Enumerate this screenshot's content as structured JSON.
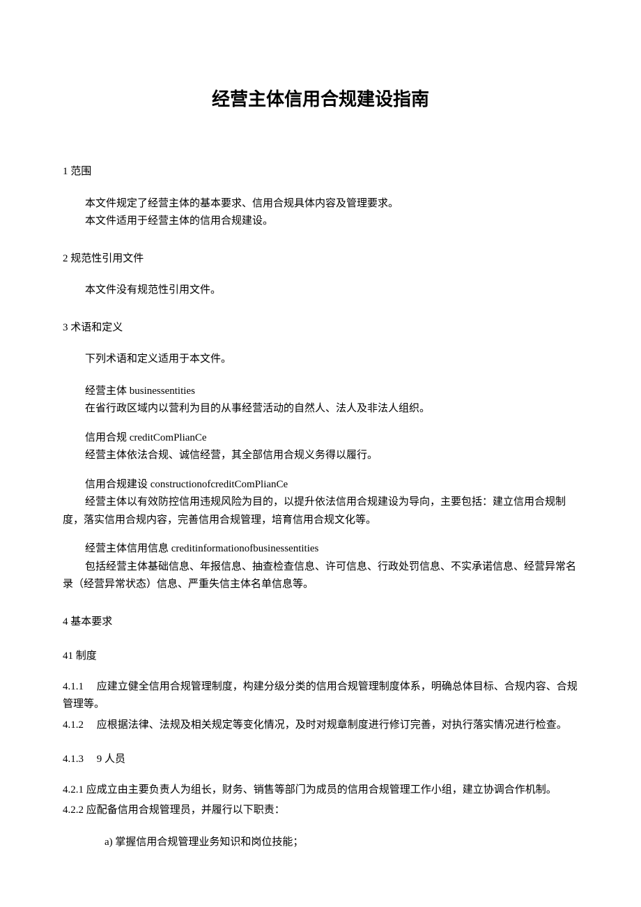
{
  "title": "经营主体信用合规建设指南",
  "s1": {
    "heading": "1 范围",
    "p1": "本文件规定了经营主体的基本要求、信用合规具体内容及管理要求。",
    "p2": "本文件适用于经营主体的信用合规建设。"
  },
  "s2": {
    "heading": "2 规范性引用文件",
    "p1": "本文件没有规范性引用文件。"
  },
  "s3": {
    "heading": "3 术语和定义",
    "intro": "下列术语和定义适用于本文件。",
    "t1": {
      "name": "经营主体 businessentities",
      "def": "在省行政区域内以营利为目的从事经营活动的自然人、法人及非法人组织。"
    },
    "t2": {
      "name": "信用合规 creditComPlianCe",
      "def": "经营主体依法合规、诚信经营，其全部信用合规义务得以履行。"
    },
    "t3": {
      "name": "信用合规建设 constructionofcreditComPlianCe",
      "def": "经营主体以有效防控信用违规风险为目的，以提升依法信用合规建设为导向，主要包括：建立信用合规制度，落实信用合规内容，完善信用合规管理，培育信用合规文化等。"
    },
    "t4": {
      "name": "经营主体信用信息 creditinformationofbusinessentities",
      "def": "包括经营主体基础信息、年报信息、抽查检查信息、许可信息、行政处罚信息、不实承诺信息、经营异常名录（经营异常状态）信息、严重失信主体名单信息等。"
    }
  },
  "s4": {
    "heading": "4 基本要求"
  },
  "s41": {
    "heading": "41 制度",
    "c1": "4.1.1　 应建立健全信用合规管理制度，构建分级分类的信用合规管理制度体系，明确总体目标、合规内容、合规管理等。",
    "c2": "4.1.2　 应根据法律、法规及相关规定等变化情况，及时对规章制度进行修订完善，对执行落实情况进行检查。"
  },
  "s413": {
    "heading": "4.1.3　 9 人员",
    "c1": "4.2.1 应成立由主要负责人为组长，财务、销售等部门为成员的信用合规管理工作小组，建立协调合作机制。",
    "c2": "4.2.2 应配备信用合规管理员，并履行以下职责：",
    "a": "a)  掌握信用合规管理业务知识和岗位技能；"
  }
}
